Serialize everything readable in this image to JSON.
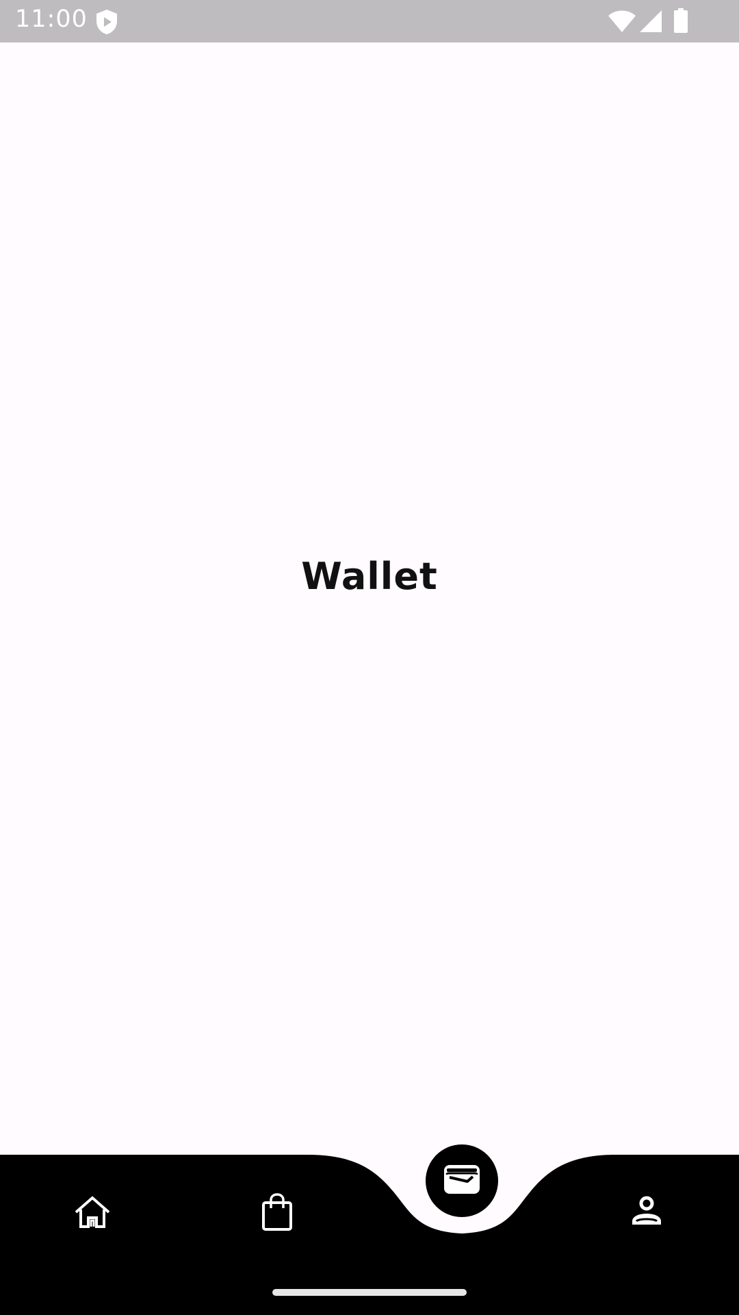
{
  "status_bar": {
    "time": "11:00",
    "icons": [
      "shield-play-icon",
      "wifi-icon",
      "signal-icon",
      "battery-icon"
    ],
    "background": "#bebcbe"
  },
  "main": {
    "title": "Wallet"
  },
  "bottom_nav": {
    "background": "#000000",
    "items": [
      {
        "icon": "home-icon",
        "selected": false
      },
      {
        "icon": "shopping-bag-icon",
        "selected": false
      },
      {
        "icon": "wallet-icon",
        "selected": true
      },
      {
        "icon": "profile-icon",
        "selected": false
      }
    ]
  },
  "colors": {
    "page_background": "#fffbfe",
    "nav_background": "#000000",
    "icon_color": "#ffffff",
    "title_color": "#111111"
  }
}
